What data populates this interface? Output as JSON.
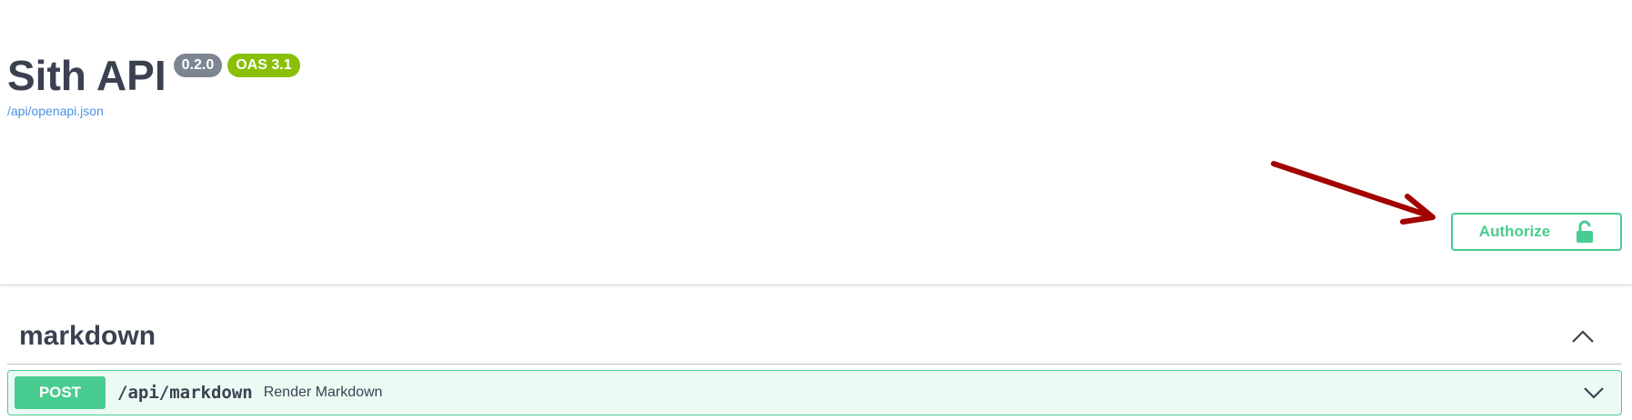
{
  "info": {
    "title": "Sith API",
    "version_badge": "0.2.0",
    "oas_badge": "OAS 3.1",
    "spec_link": "/api/openapi.json"
  },
  "authorize": {
    "label": "Authorize",
    "icon": "lock-icon"
  },
  "annotation": {
    "icon": "arrow-icon",
    "color": "#a30000"
  },
  "tag": {
    "name": "markdown",
    "toggle_icon": "chevron-up-icon"
  },
  "operation": {
    "method": "POST",
    "path": "/api/markdown",
    "summary": "Render Markdown",
    "toggle_icon": "chevron-down-icon"
  },
  "colors": {
    "post": "#49cc90",
    "version_badge": "#7d8492",
    "oas_badge": "#89bf04",
    "link": "#4990e2",
    "text": "#3b4151"
  }
}
